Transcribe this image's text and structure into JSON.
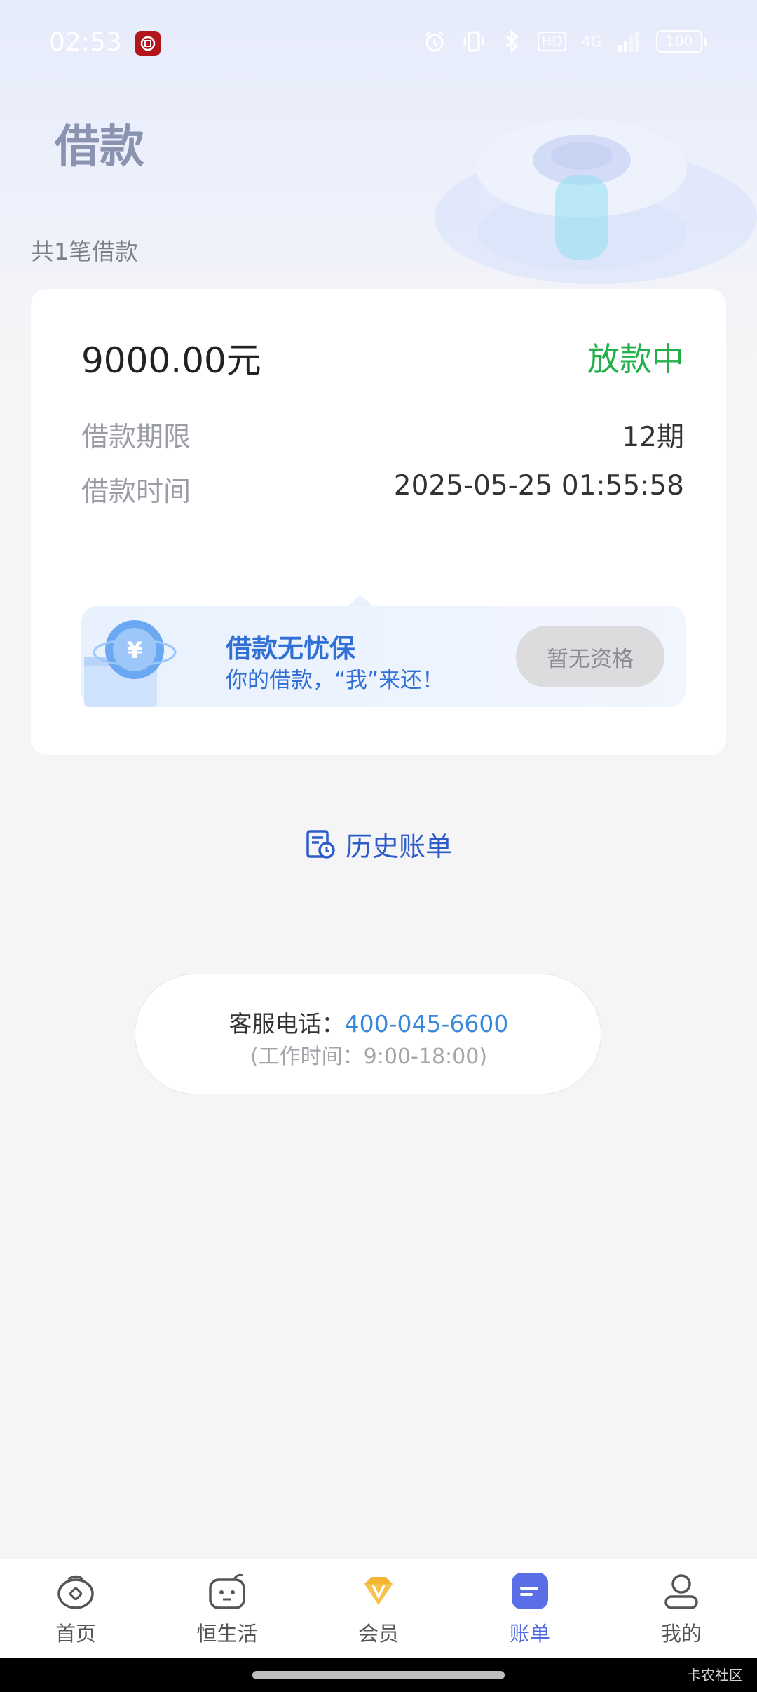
{
  "status_bar": {
    "time": "02:53",
    "hd_label": "HD",
    "signal_label": "4G",
    "battery": "100"
  },
  "header": {
    "title": "借款",
    "loan_count": "共1笔借款"
  },
  "loan": {
    "amount": "9000.00元",
    "status": "放款中",
    "term_label": "借款期限",
    "term_value": "12期",
    "time_label": "借款时间",
    "time_value": "2025-05-25 01:55:58"
  },
  "insurance": {
    "title": "借款无忧保",
    "subtitle": "你的借款，“我”来还！",
    "button": "暂无资格",
    "icon_symbol": "¥"
  },
  "history": {
    "label": "历史账单"
  },
  "service": {
    "label": "客服电话：",
    "phone": "400-045-6600",
    "hours": "(工作时间：9:00-18:00)"
  },
  "tabs": [
    {
      "label": "首页",
      "icon": "home-icon"
    },
    {
      "label": "恒生活",
      "icon": "life-icon"
    },
    {
      "label": "会员",
      "icon": "vip-icon"
    },
    {
      "label": "账单",
      "icon": "bill-icon"
    },
    {
      "label": "我的",
      "icon": "profile-icon"
    }
  ],
  "watermark": "卡农社区",
  "colors": {
    "status_green": "#23b04b",
    "accent_blue": "#2f6fd6",
    "phone_blue": "#3a88de",
    "tab_active": "#4d6be0"
  }
}
